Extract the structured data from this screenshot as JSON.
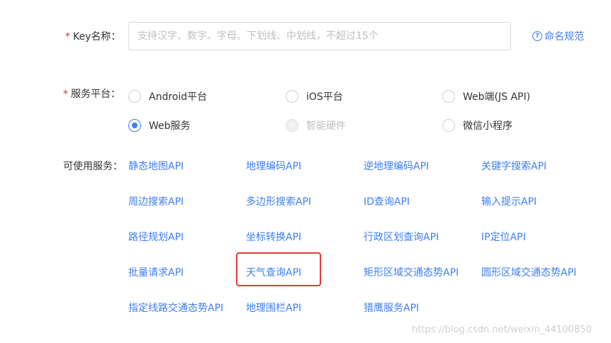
{
  "key_name": {
    "required_mark": "*",
    "label": "Key名称：",
    "value": "",
    "placeholder": "支持汉字、数字、字母、下划线、中划线，不超过15个",
    "help_icon": "question-circle-icon",
    "help_link": "命名规范"
  },
  "platform": {
    "required_mark": "*",
    "label": "服务平台：",
    "options": [
      {
        "label": "Android平台",
        "checked": false,
        "disabled": false
      },
      {
        "label": "iOS平台",
        "checked": false,
        "disabled": false
      },
      {
        "label": "Web端(JS API)",
        "checked": false,
        "disabled": false
      },
      {
        "label": "Web服务",
        "checked": true,
        "disabled": false
      },
      {
        "label": "智能硬件",
        "checked": false,
        "disabled": true
      },
      {
        "label": "微信小程序",
        "checked": false,
        "disabled": false
      }
    ]
  },
  "services": {
    "label": "可使用服务：",
    "items": [
      "静态地图API",
      "地理编码API",
      "逆地理编码API",
      "关键字搜索API",
      "周边搜索API",
      "多边形搜索API",
      "ID查询API",
      "输入提示API",
      "路径规划API",
      "坐标转换API",
      "行政区划查询API",
      "IP定位API",
      "批量请求API",
      "天气查询API",
      "矩形区域交通态势API",
      "圆形区域交通态势API",
      "指定线路交通态势API",
      "地理围栏API",
      "猎鹰服务API"
    ],
    "highlighted": "天气查询API"
  },
  "colors": {
    "accent": "#3f7ef0",
    "required": "#f5222d",
    "highlight_box": "#e53935"
  },
  "watermark": "https://blog.csdn.net/weixin_44100850"
}
